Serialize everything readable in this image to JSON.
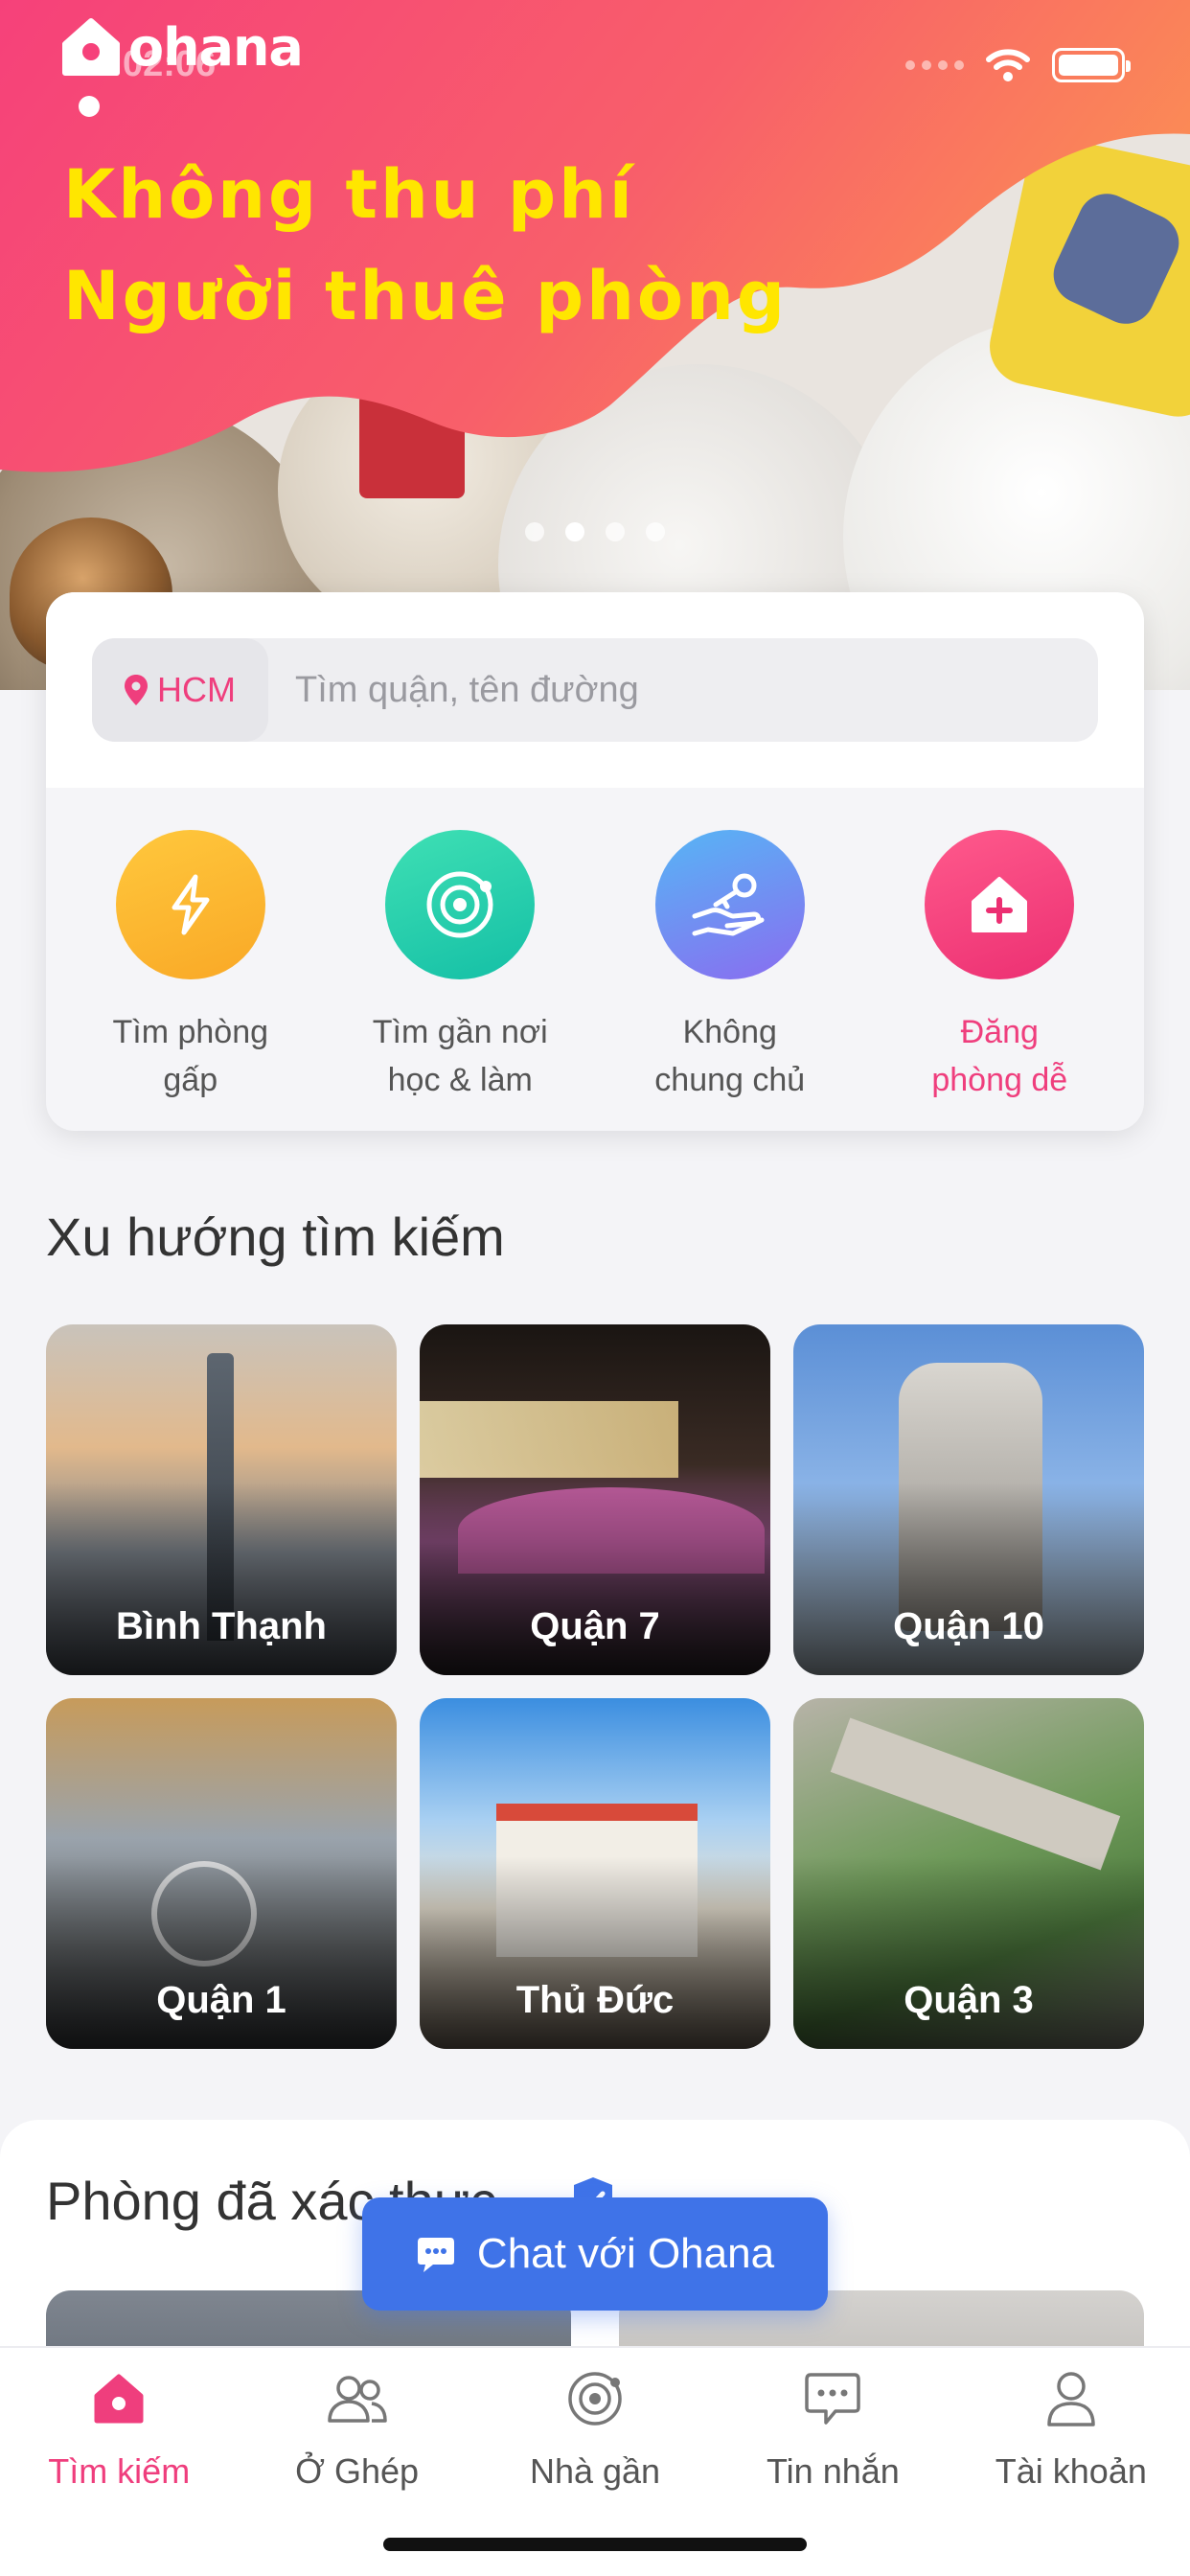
{
  "status_bar": {
    "time": "02:06"
  },
  "brand": {
    "name": "ohana",
    "accent": "#ef3e7d",
    "banner_text_color": "#ffe600"
  },
  "hero": {
    "line1": "Không thu phí",
    "line2": "Người thuê phòng",
    "carousel_active_index": 1,
    "carousel_count": 4
  },
  "search": {
    "city": "HCM",
    "placeholder": "Tìm quận, tên đường"
  },
  "quick_actions": [
    {
      "label": "Tìm phòng\ngấp",
      "icon": "lightning-icon",
      "color": "#f9a826"
    },
    {
      "label": "Tìm gần nơi\nhọc & làm",
      "icon": "orbit-target-icon",
      "color": "#22c9a8"
    },
    {
      "label": "Không\nchung chủ",
      "icon": "hand-key-icon",
      "color": "#7a7ef0"
    },
    {
      "label": "Đăng\nphòng dễ",
      "icon": "house-plus-icon",
      "color": "#ef3e7d"
    }
  ],
  "trends": {
    "title": "Xu hướng tìm kiếm",
    "items": [
      {
        "label": "Bình Thạnh"
      },
      {
        "label": "Quận 7"
      },
      {
        "label": "Quận 10"
      },
      {
        "label": "Quận 1"
      },
      {
        "label": "Thủ Đức"
      },
      {
        "label": "Quận 3"
      }
    ]
  },
  "verified": {
    "title": "Phòng đã xác thực"
  },
  "chat": {
    "label": "Chat với Ohana"
  },
  "bottom_nav": [
    {
      "label": "Tìm kiếm",
      "icon": "home-icon",
      "active": true
    },
    {
      "label": "Ở Ghép",
      "icon": "roommates-icon",
      "active": false
    },
    {
      "label": "Nhà gần",
      "icon": "nearby-icon",
      "active": false
    },
    {
      "label": "Tin nhắn",
      "icon": "message-icon",
      "active": false
    },
    {
      "label": "Tài khoản",
      "icon": "account-icon",
      "active": false
    }
  ]
}
